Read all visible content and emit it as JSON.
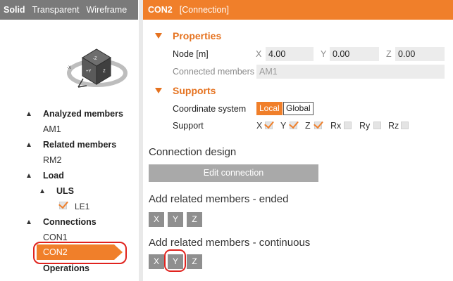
{
  "view_tabs": [
    "Solid",
    "Transparent",
    "Wireframe"
  ],
  "cube": {
    "face_y": "+Y",
    "face_z": "Z",
    "face_top": "-Z",
    "side_x": "-X"
  },
  "tree": {
    "analyzed_members": {
      "label": "Analyzed members",
      "items": [
        "AM1"
      ]
    },
    "related_members": {
      "label": "Related members",
      "items": [
        "RM2"
      ]
    },
    "load": {
      "label": "Load",
      "uls_label": "ULS",
      "le_item": "LE1"
    },
    "connections": {
      "label": "Connections",
      "items": [
        "CON1",
        "CON2"
      ]
    },
    "operations": {
      "label": "Operations"
    }
  },
  "header": {
    "name": "CON2",
    "type": "[Connection]"
  },
  "properties": {
    "title": "Properties",
    "node_label": "Node [m]",
    "x_label": "X",
    "x_value": "4.00",
    "y_label": "Y",
    "y_value": "0.00",
    "z_label": "Z",
    "z_value": "0.00",
    "connected_label": "Connected members",
    "connected_value": "AM1"
  },
  "supports": {
    "title": "Supports",
    "coord_label": "Coordinate system",
    "coord_options": [
      "Local",
      "Global"
    ],
    "coord_selected": "Local",
    "support_label": "Support",
    "checks": [
      {
        "label": "X",
        "checked": true
      },
      {
        "label": "Y",
        "checked": true
      },
      {
        "label": "Z",
        "checked": true
      },
      {
        "label": "Rx",
        "checked": false
      },
      {
        "label": "Ry",
        "checked": false
      },
      {
        "label": "Rz",
        "checked": false
      }
    ]
  },
  "connection_design": {
    "title": "Connection design",
    "button": "Edit connection"
  },
  "add_ended": {
    "title": "Add related members - ended",
    "buttons": [
      "X",
      "Y",
      "Z"
    ]
  },
  "add_continuous": {
    "title": "Add related members - continuous",
    "buttons": [
      "X",
      "Y",
      "Z"
    ]
  },
  "colors": {
    "accent": "#f07f2a",
    "highlight": "#e0231e",
    "tab_bar": "#7a7a7a"
  }
}
